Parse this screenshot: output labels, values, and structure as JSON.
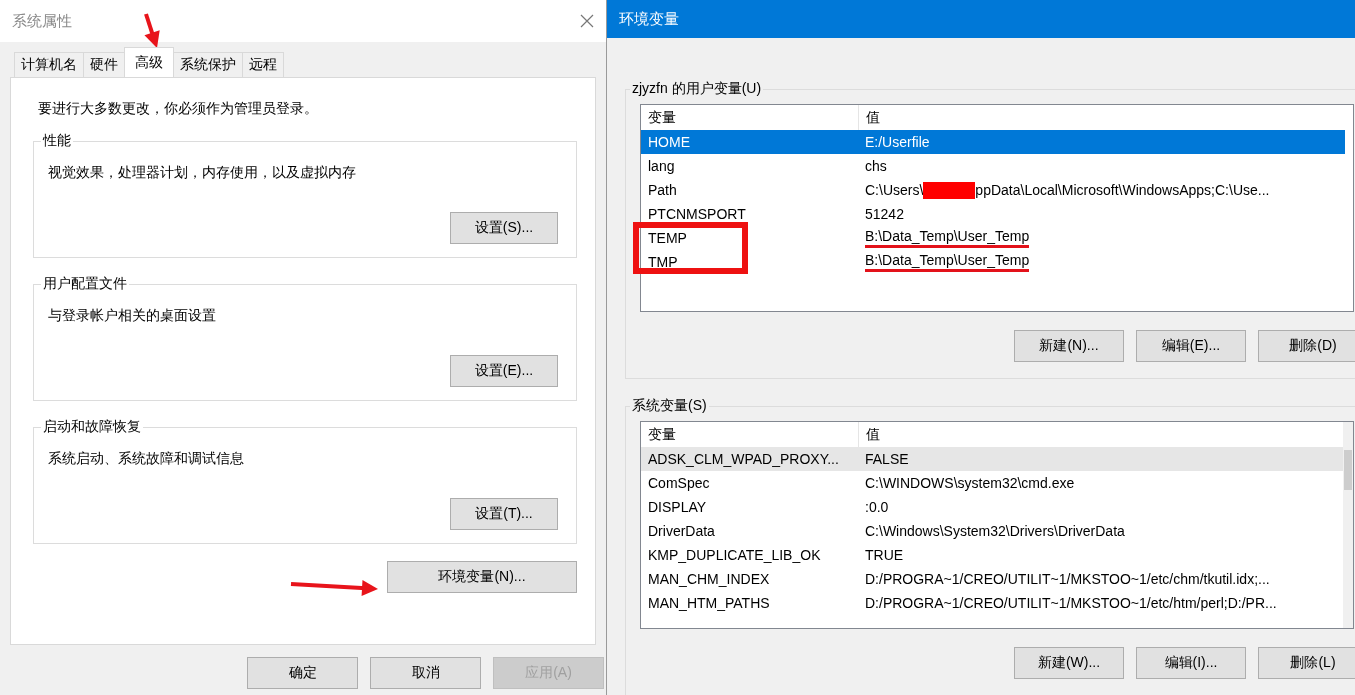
{
  "system_properties": {
    "title": "系统属性",
    "tabs": [
      {
        "label": "计算机名",
        "selected": false
      },
      {
        "label": "硬件",
        "selected": false
      },
      {
        "label": "高级",
        "selected": true
      },
      {
        "label": "系统保护",
        "selected": false
      },
      {
        "label": "远程",
        "selected": false
      }
    ],
    "notice": "要进行大多数更改，你必须作为管理员登录。",
    "groups": [
      {
        "title": "性能",
        "description": "视觉效果，处理器计划，内存使用，以及虚拟内存",
        "button": "设置(S)..."
      },
      {
        "title": "用户配置文件",
        "description": "与登录帐户相关的桌面设置",
        "button": "设置(E)..."
      },
      {
        "title": "启动和故障恢复",
        "description": "系统启动、系统故障和调试信息",
        "button": "设置(T)..."
      }
    ],
    "env_button": "环境变量(N)...",
    "buttons": [
      {
        "label": "确定",
        "disabled": false
      },
      {
        "label": "取消",
        "disabled": false
      },
      {
        "label": "应用(A)",
        "disabled": true
      }
    ]
  },
  "environment_variables": {
    "title": "环境变量",
    "lists": [
      {
        "title": "zjyzfn 的用户变量(U)",
        "focused": true,
        "scrollbar": false,
        "columns": [
          "变量",
          "值"
        ],
        "rows": [
          {
            "name": "HOME",
            "value": "E:/Userfile",
            "selected": true
          },
          {
            "name": "lang",
            "value": "chs",
            "selected": false
          },
          {
            "name": "Path",
            "value": "C:\\Users\\",
            "redacted": true,
            "value_after": "ppData\\Local\\Microsoft\\WindowsApps;C:\\Use...",
            "selected": false
          },
          {
            "name": "PTCNMSPORT",
            "value": "51242",
            "selected": false
          },
          {
            "name": "TEMP",
            "value": "B:\\Data_Temp\\User_Temp",
            "underlined": true,
            "selected": false
          },
          {
            "name": "TMP",
            "value": "B:\\Data_Temp\\User_Temp",
            "underlined": true,
            "selected": false
          }
        ],
        "buttons": [
          "新建(N)...",
          "编辑(E)...",
          "删除(D)"
        ]
      },
      {
        "title": "系统变量(S)",
        "focused": false,
        "scrollbar": true,
        "columns": [
          "变量",
          "值"
        ],
        "rows": [
          {
            "name": "ADSK_CLM_WPAD_PROXY...",
            "value": "FALSE",
            "selected": true
          },
          {
            "name": "ComSpec",
            "value": "C:\\WINDOWS\\system32\\cmd.exe",
            "selected": false
          },
          {
            "name": "DISPLAY",
            "value": ":0.0",
            "selected": false
          },
          {
            "name": "DriverData",
            "value": "C:\\Windows\\System32\\Drivers\\DriverData",
            "selected": false
          },
          {
            "name": "KMP_DUPLICATE_LIB_OK",
            "value": "TRUE",
            "selected": false
          },
          {
            "name": "MAN_CHM_INDEX",
            "value": "D:/PROGRA~1/CREO/UTILIT~1/MKSTOO~1/etc/chm/tkutil.idx;...",
            "selected": false
          },
          {
            "name": "MAN_HTM_PATHS",
            "value": "D:/PROGRA~1/CREO/UTILIT~1/MKSTOO~1/etc/htm/perl;D:/PR...",
            "selected": false
          }
        ],
        "buttons": [
          "新建(W)...",
          "编辑(I)...",
          "删除(L)"
        ]
      }
    ]
  },
  "annotations": [
    {
      "kind": "arrow"
    },
    {
      "kind": "arrow"
    },
    {
      "kind": "frame"
    }
  ]
}
